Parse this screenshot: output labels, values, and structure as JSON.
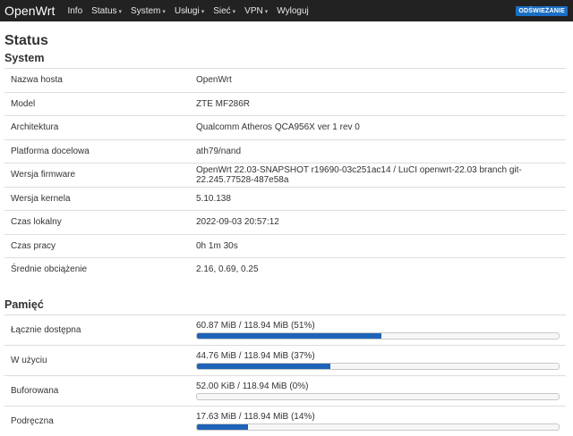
{
  "nav": {
    "brand": "OpenWrt",
    "items": [
      {
        "label": "Info",
        "dropdown": false
      },
      {
        "label": "Status",
        "dropdown": true
      },
      {
        "label": "System",
        "dropdown": true
      },
      {
        "label": "Usługi",
        "dropdown": true
      },
      {
        "label": "Sieć",
        "dropdown": true
      },
      {
        "label": "VPN",
        "dropdown": true
      },
      {
        "label": "Wyloguj",
        "dropdown": false
      }
    ],
    "refresh_label": "ODŚWIEŻANIE",
    "caret": "▾"
  },
  "page_title": "Status",
  "system": {
    "title": "System",
    "rows": [
      {
        "label": "Nazwa hosta",
        "value": "OpenWrt"
      },
      {
        "label": "Model",
        "value": "ZTE MF286R"
      },
      {
        "label": "Architektura",
        "value": "Qualcomm Atheros QCA956X ver 1 rev 0"
      },
      {
        "label": "Platforma docelowa",
        "value": "ath79/nand"
      },
      {
        "label": "Wersja firmware",
        "value": "OpenWrt 22.03-SNAPSHOT r19690-03c251ac14 / LuCI openwrt-22.03 branch git-22.245.77528-487e58a"
      },
      {
        "label": "Wersja kernela",
        "value": "5.10.138"
      },
      {
        "label": "Czas lokalny",
        "value": "2022-09-03 20:57:12"
      },
      {
        "label": "Czas pracy",
        "value": "0h 1m 30s"
      },
      {
        "label": "Średnie obciążenie",
        "value": "2.16, 0.69, 0.25"
      }
    ]
  },
  "memory": {
    "title": "Pamięć",
    "rows": [
      {
        "label": "Łącznie dostępna",
        "value": "60.87 MiB / 118.94 MiB (51%)",
        "percent": 51
      },
      {
        "label": "W użyciu",
        "value": "44.76 MiB / 118.94 MiB (37%)",
        "percent": 37
      },
      {
        "label": "Buforowana",
        "value": "52.00 KiB / 118.94 MiB (0%)",
        "percent": 0
      },
      {
        "label": "Podręczna",
        "value": "17.63 MiB / 118.94 MiB (14%)",
        "percent": 14
      }
    ]
  },
  "colors": {
    "accent": "#1f63b8",
    "navbar": "#222222",
    "refresh": "#1a6fc4"
  }
}
